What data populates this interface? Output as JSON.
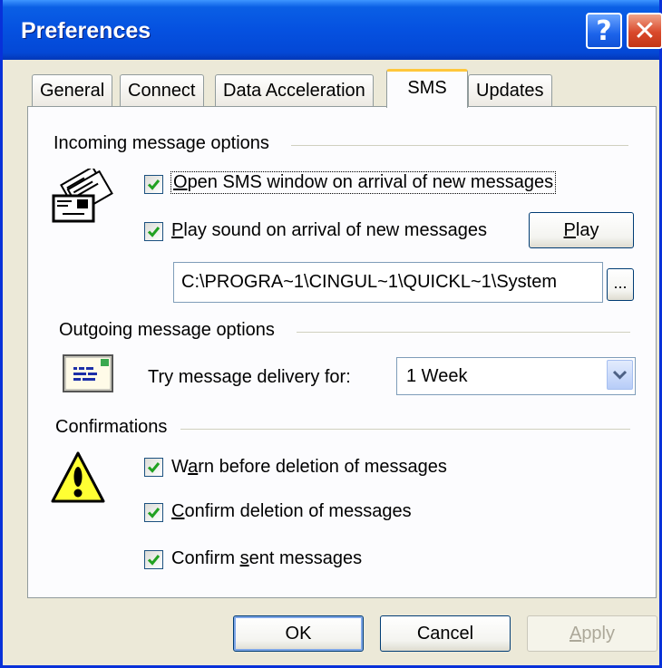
{
  "window": {
    "title": "Preferences"
  },
  "tabs": [
    "General",
    "Connect",
    "Data Acceleration",
    "SMS",
    "Updates"
  ],
  "active_tab": "SMS",
  "incoming": {
    "heading": "Incoming message options",
    "open_window": {
      "label_key": "O",
      "label_rest": "pen SMS window on arrival of new messages",
      "checked": true
    },
    "play_sound": {
      "label_key": "P",
      "label_rest": "lay sound on arrival of new messages",
      "checked": true
    },
    "play_button": {
      "key": "P",
      "rest": "lay"
    },
    "sound_path": "C:\\PROGRA~1\\CINGUL~1\\QUICKL~1\\System",
    "browse_button": "..."
  },
  "outgoing": {
    "heading": "Outgoing message options",
    "delivery_label": "Try message delivery for:",
    "delivery_value": "1 Week"
  },
  "confirmations": {
    "heading": "Confirmations",
    "warn_delete": {
      "pre": "W",
      "key": "a",
      "rest": "rn before deletion of messages",
      "checked": true
    },
    "confirm_delete": {
      "key": "C",
      "rest": "onfirm deletion of messages",
      "checked": true
    },
    "confirm_sent": {
      "pre": "Confirm ",
      "key": "s",
      "rest": "ent messages",
      "checked": true
    }
  },
  "buttons": {
    "ok": "OK",
    "cancel": "Cancel",
    "apply_key": "A",
    "apply_rest": "pply"
  },
  "colors": {
    "title_blue": "#0551e0",
    "close_red": "#d9492b",
    "check_green": "#21a121",
    "tab_highlight": "#ffc73c",
    "window_bg": "#ece9d8"
  }
}
